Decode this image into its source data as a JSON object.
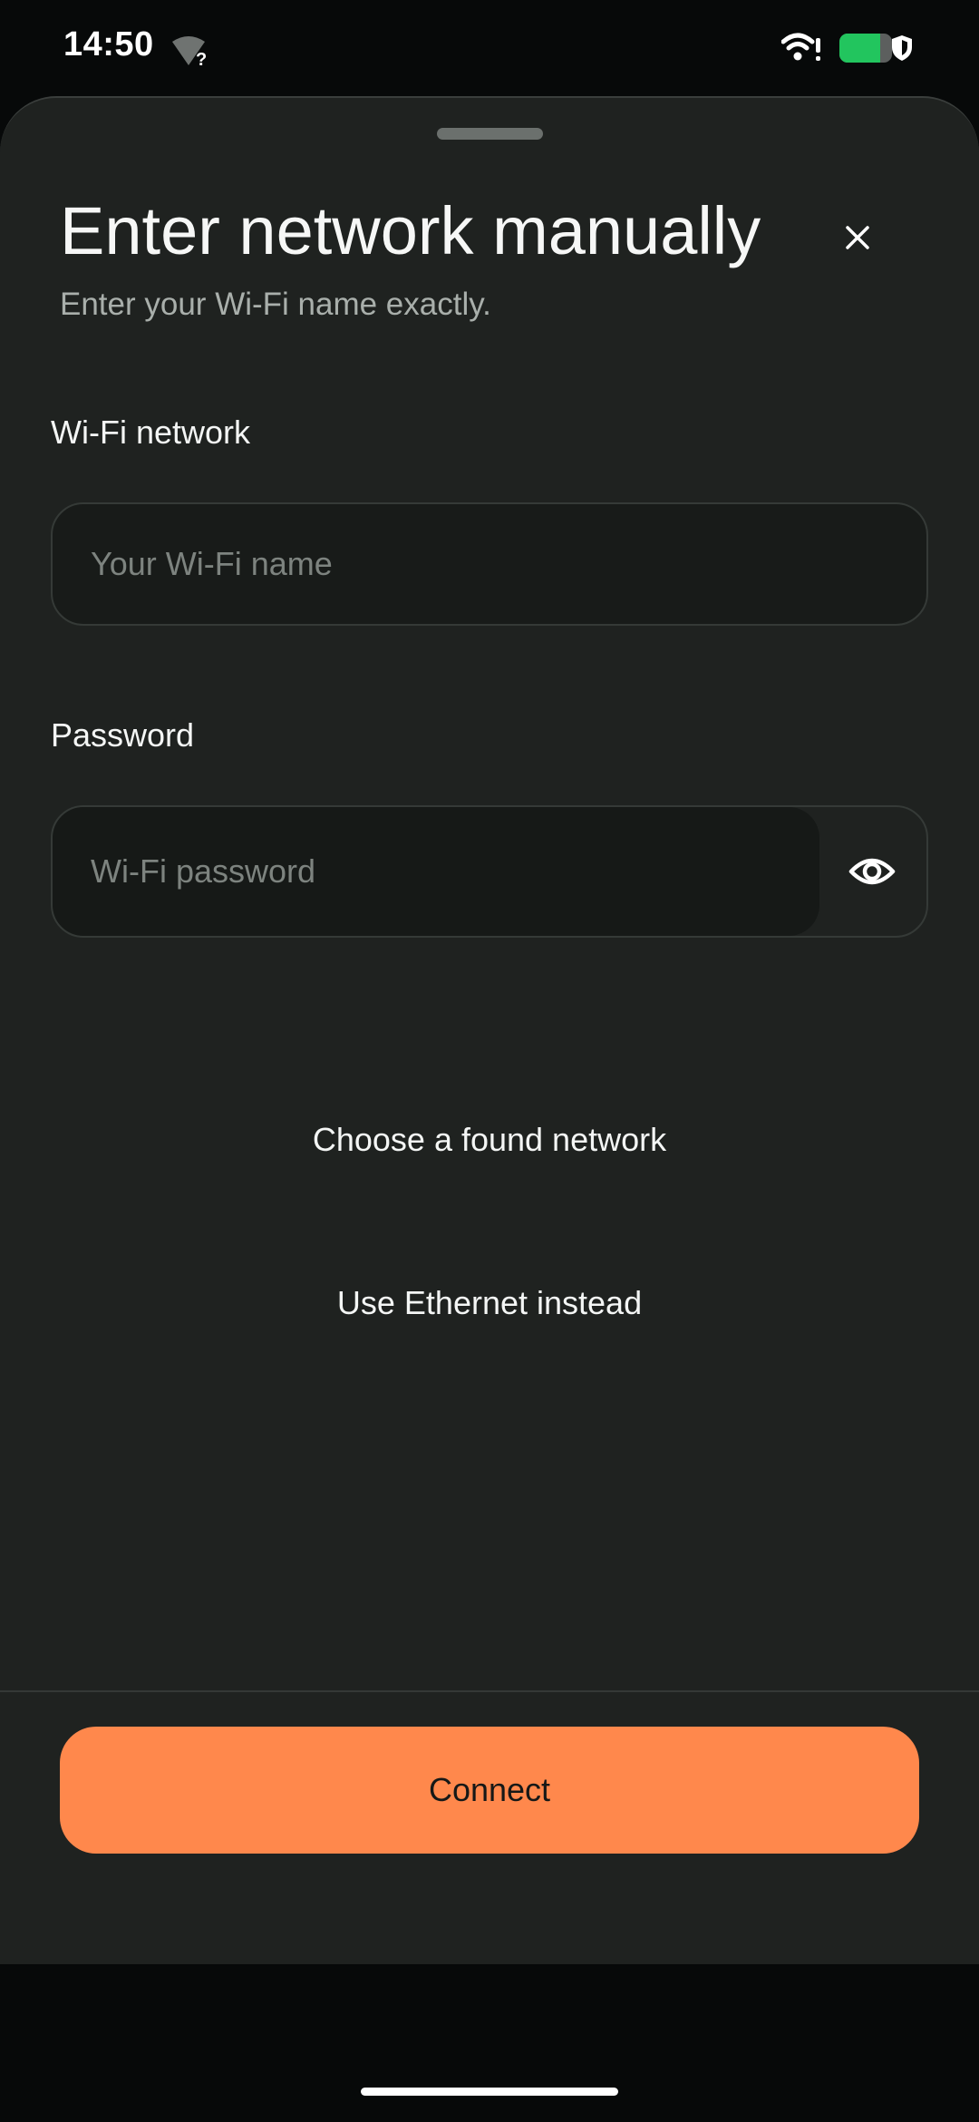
{
  "status_bar": {
    "time": "14:50",
    "wifi_unknown_mark": "?",
    "battery_level": 0.78,
    "icons": [
      "wifi-unknown-icon",
      "wifi-alert-icon",
      "battery-icon",
      "shield-icon"
    ],
    "battery_color": "#22c55e"
  },
  "sheet": {
    "title": "Enter network manually",
    "subtitle": "Enter your Wi-Fi name exactly.",
    "close_icon": "close-icon",
    "network_field": {
      "label": "Wi-Fi network",
      "value": "",
      "placeholder": "Your Wi-Fi name"
    },
    "password_field": {
      "label": "Password",
      "value": "",
      "placeholder": "Wi-Fi password",
      "toggle_icon": "eye-icon"
    },
    "links": {
      "found_network": "Choose a found network",
      "ethernet": "Use Ethernet instead"
    },
    "connect_label": "Connect"
  },
  "colors": {
    "accent": "#ff884c",
    "sheet_background": "#1f2220",
    "page_background": "#070909"
  }
}
